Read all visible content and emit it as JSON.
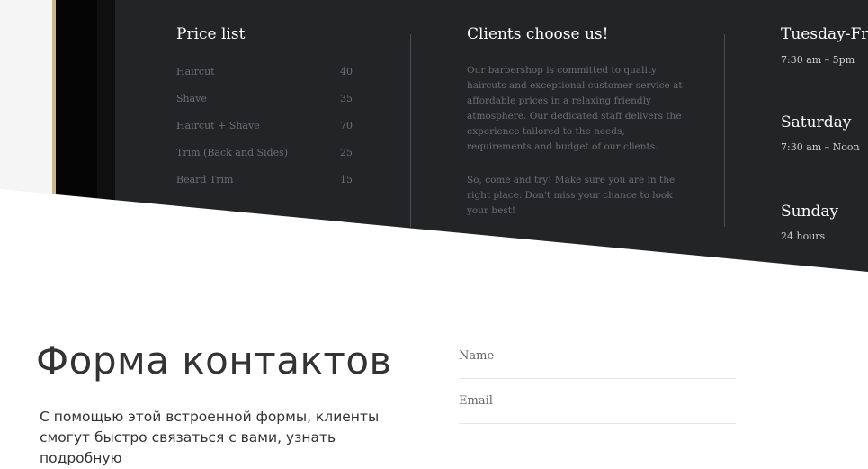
{
  "price_list": {
    "title": "Price list",
    "items": [
      {
        "name": "Haircut",
        "price": "40"
      },
      {
        "name": "Shave",
        "price": "35"
      },
      {
        "name": "Haircut + Shave",
        "price": "70"
      },
      {
        "name": "Trim (Back and Sides)",
        "price": "25"
      },
      {
        "name": "Beard Trim",
        "price": "15"
      }
    ]
  },
  "about": {
    "title": "Clients choose us!",
    "paragraph1": "Our barbershop is committed to quality haircuts and exceptional customer service at affordable prices in a relaxing friendly atmosphere. Our dedicated staff delivers the experience tailored to the needs, requirements and budget of our clients.",
    "paragraph2": "So, come and try! Make sure you are in the right place. Don't miss your chance to look your best!"
  },
  "hours": [
    {
      "day": "Tuesday-Fri",
      "time": "7:30 am – 5pm"
    },
    {
      "day": "Saturday",
      "time": "7:30 am – Noon"
    },
    {
      "day": "Sunday",
      "time": "24 hours"
    }
  ],
  "contact": {
    "title": "Форма контактов",
    "description": "С помощью этой встроенной формы, клиенты смогут быстро связаться с вами, узнать подробную",
    "name_placeholder": "Name",
    "email_placeholder": "Email"
  },
  "colors": {
    "dark_panel": "#222426",
    "frame_gold": "#cdb68a",
    "text_muted": "#6b6e71"
  }
}
